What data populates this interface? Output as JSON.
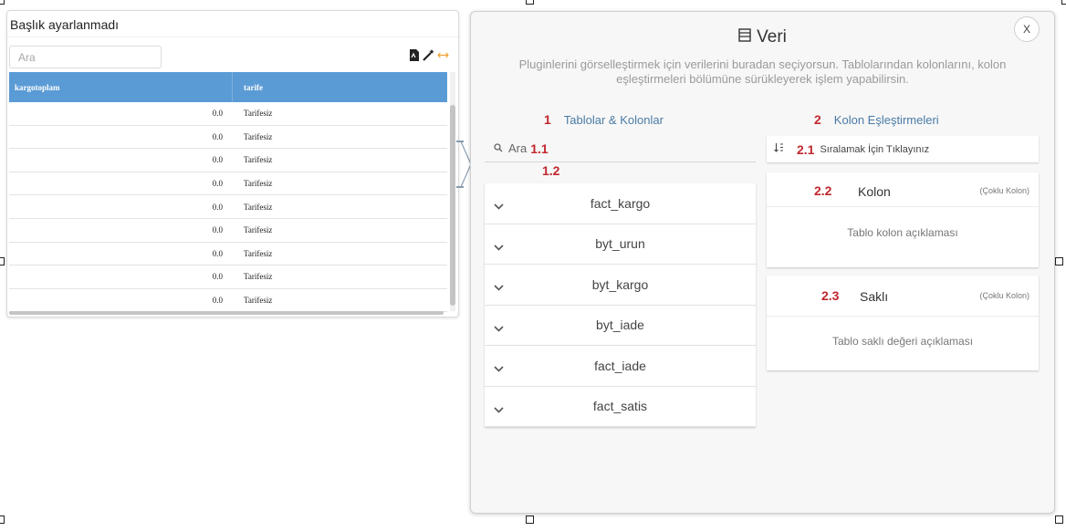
{
  "widget": {
    "title": "Başlık ayarlanmadı",
    "search_placeholder": "Ara",
    "columns": [
      "kargotoplam",
      "tarife"
    ],
    "rows": [
      [
        "0.0",
        "Tarifesiz"
      ],
      [
        "0.0",
        "Tarifesiz"
      ],
      [
        "0.0",
        "Tarifesiz"
      ],
      [
        "0.0",
        "Tarifesiz"
      ],
      [
        "0.0",
        "Tarifesiz"
      ],
      [
        "0.0",
        "Tarifesiz"
      ],
      [
        "0.0",
        "Tarifesiz"
      ],
      [
        "0.0",
        "Tarifesiz"
      ],
      [
        "0.0",
        "Tarifesiz"
      ]
    ],
    "icons": [
      "pdf-export-icon",
      "magic-wand-icon",
      "resize-horizontal-icon"
    ],
    "header_color": "#5b9bd5"
  },
  "panel": {
    "close_label": "X",
    "title": "Veri",
    "description": "Pluginlerini görselleştirmek için verilerini buradan seçiyorsun. Tablolarından kolonlarını, kolon eşleştirmeleri bölümüne sürükleyerek işlem yapabilirsin.",
    "left": {
      "num": "1",
      "heading": "Tablolar & Kolonlar",
      "search_label": "Ara",
      "search_num": "1.1",
      "list_num": "1.2",
      "tables": [
        "fact_kargo",
        "byt_urun",
        "byt_kargo",
        "byt_iade",
        "fact_iade",
        "fact_satis"
      ]
    },
    "right": {
      "num": "2",
      "heading": "Kolon Eşleştirmeleri",
      "sort_num": "2.1",
      "sort_text": "Sıralamak İçin Tıklayınız",
      "kolon": {
        "num": "2.2",
        "name": "Kolon",
        "multi": "(Çoklu Kolon)",
        "desc": "Tablo kolon açıklaması"
      },
      "sakli": {
        "num": "2.3",
        "name": "Saklı",
        "multi": "(Çoklu Kolon)",
        "desc": "Tablo saklı değeri açıklaması"
      }
    },
    "accent_color": "#4a7ba6",
    "number_color": "#c0272d"
  }
}
